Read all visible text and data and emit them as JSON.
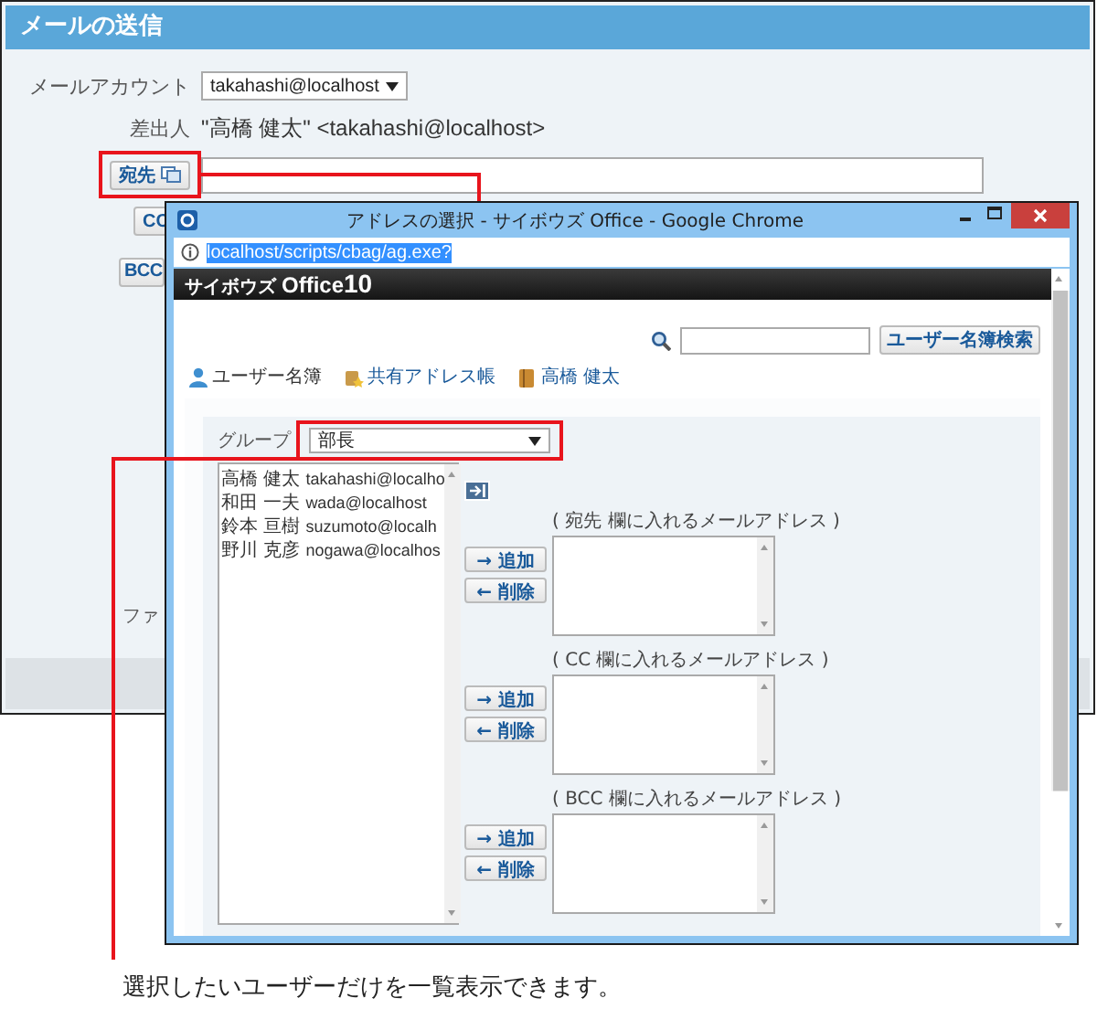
{
  "mail_form": {
    "title": "メールの送信",
    "account_label": "メールアカウント",
    "account_value": "takahashi@localhost",
    "sender_label": "差出人",
    "sender_value": "\"高橋 健太\" <takahashi@localhost>",
    "to_button": "宛先",
    "cc_button": "CC",
    "bcc_button": "BCC",
    "file_label": "ファ"
  },
  "popup": {
    "title": "アドレスの選択 - サイボウズ Office - Google Chrome",
    "url": "localhost/scripts/cbag/ag.exe?",
    "logo_brand": "サイボウズ",
    "logo_product": "Office",
    "logo_version": "10",
    "search_button": "ユーザー名簿検索",
    "tabs": [
      {
        "kind": "person",
        "label": "ユーザー名簿"
      },
      {
        "kind": "shared",
        "label": "共有アドレス帳"
      },
      {
        "kind": "book",
        "label": "高橋 健太"
      }
    ],
    "group_label": "グループ",
    "group_value": "部長",
    "users": [
      {
        "name": "高橋 健太",
        "email": "takahashi@localho"
      },
      {
        "name": "和田 一夫",
        "email": "wada@localhost"
      },
      {
        "name": "鈴本 亘樹",
        "email": "suzumoto@localh"
      },
      {
        "name": "野川 克彦",
        "email": "nogawa@localhos"
      }
    ],
    "targets": [
      {
        "label": "( 宛先 欄に入れるメールアドレス )",
        "add": "→ 追加",
        "remove": "← 削除"
      },
      {
        "label": "( CC 欄に入れるメールアドレス )",
        "add": "→ 追加",
        "remove": "← 削除"
      },
      {
        "label": "( BCC 欄に入れるメールアドレス )",
        "add": "→ 追加",
        "remove": "← 削除"
      }
    ]
  },
  "annotation": {
    "caption": "選択したいユーザーだけを一覧表示できます。"
  }
}
